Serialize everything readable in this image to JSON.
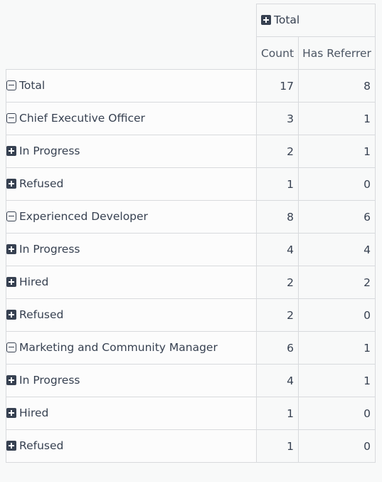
{
  "header": {
    "col_group_label": "Total",
    "col_group_icon": "plus-square-icon",
    "measures": [
      "Count",
      "Has Referrer"
    ]
  },
  "rows": [
    {
      "level": 0,
      "label": "Total",
      "icon": "minus-square-icon",
      "count": "17",
      "has_referrer": "8"
    },
    {
      "level": 1,
      "label": "Chief Executive Officer",
      "icon": "minus-square-icon",
      "count": "3",
      "has_referrer": "1"
    },
    {
      "level": 2,
      "label": "In Progress",
      "icon": "plus-square-icon",
      "count": "2",
      "has_referrer": "1"
    },
    {
      "level": 2,
      "label": "Refused",
      "icon": "plus-square-icon",
      "count": "1",
      "has_referrer": "0"
    },
    {
      "level": 1,
      "label": "Experienced Developer",
      "icon": "minus-square-icon",
      "count": "8",
      "has_referrer": "6"
    },
    {
      "level": 2,
      "label": "In Progress",
      "icon": "plus-square-icon",
      "count": "4",
      "has_referrer": "4"
    },
    {
      "level": 2,
      "label": "Hired",
      "icon": "plus-square-icon",
      "count": "2",
      "has_referrer": "2"
    },
    {
      "level": 2,
      "label": "Refused",
      "icon": "plus-square-icon",
      "count": "2",
      "has_referrer": "0"
    },
    {
      "level": 1,
      "label": "Marketing and Community Manager",
      "icon": "minus-square-icon",
      "count": "6",
      "has_referrer": "1"
    },
    {
      "level": 2,
      "label": "In Progress",
      "icon": "plus-square-icon",
      "count": "4",
      "has_referrer": "1"
    },
    {
      "level": 2,
      "label": "Hired",
      "icon": "plus-square-icon",
      "count": "1",
      "has_referrer": "0"
    },
    {
      "level": 2,
      "label": "Refused",
      "icon": "plus-square-icon",
      "count": "1",
      "has_referrer": "0"
    }
  ]
}
